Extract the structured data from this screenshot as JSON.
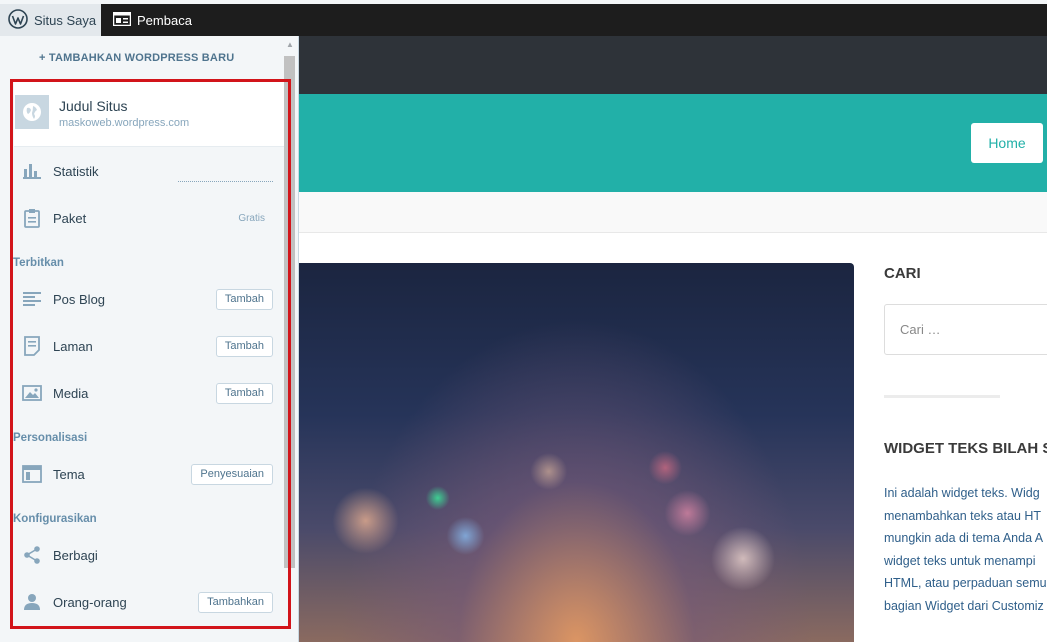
{
  "masterbar": {
    "my_sites": "Situs Saya",
    "reader": "Pembaca"
  },
  "sidebar": {
    "add_new": "+ TAMBAHKAN WORDPRESS BARU",
    "site": {
      "title": "Judul Situs",
      "url": "maskoweb.wordpress.com"
    },
    "items": [
      {
        "label": "Statistik",
        "icon": "stats-icon"
      },
      {
        "label": "Paket",
        "icon": "plan-icon",
        "note": "Gratis"
      }
    ],
    "sections": {
      "publish": "Terbitkan",
      "personalize": "Personalisasi",
      "configure": "Konfigurasikan"
    },
    "publish_items": [
      {
        "label": "Pos Blog",
        "icon": "posts-icon",
        "button": "Tambah"
      },
      {
        "label": "Laman",
        "icon": "pages-icon",
        "button": "Tambah"
      },
      {
        "label": "Media",
        "icon": "media-icon",
        "button": "Tambah"
      }
    ],
    "personalize_items": [
      {
        "label": "Tema",
        "icon": "themes-icon",
        "button": "Penyesuaian"
      }
    ],
    "configure_items": [
      {
        "label": "Berbagi",
        "icon": "share-icon"
      },
      {
        "label": "Orang-orang",
        "icon": "people-icon",
        "button": "Tambahkan"
      }
    ]
  },
  "preview": {
    "nav_home": "Home",
    "search_title": "CARI",
    "search_placeholder": "Cari …",
    "text_widget_title": "WIDGET TEKS BILAH SIS",
    "text_widget_lines": [
      "Ini adalah widget teks. Widg",
      "menambahkan teks atau HT",
      "mungkin ada di tema Anda A",
      "widget teks untuk menampi",
      "HTML, atau perpaduan semu",
      "bagian Widget dari Customiz"
    ]
  },
  "colors": {
    "masterbar_bg": "#1d1d1d",
    "teal_header": "#22b0a8",
    "highlight_border": "#d2141a"
  }
}
